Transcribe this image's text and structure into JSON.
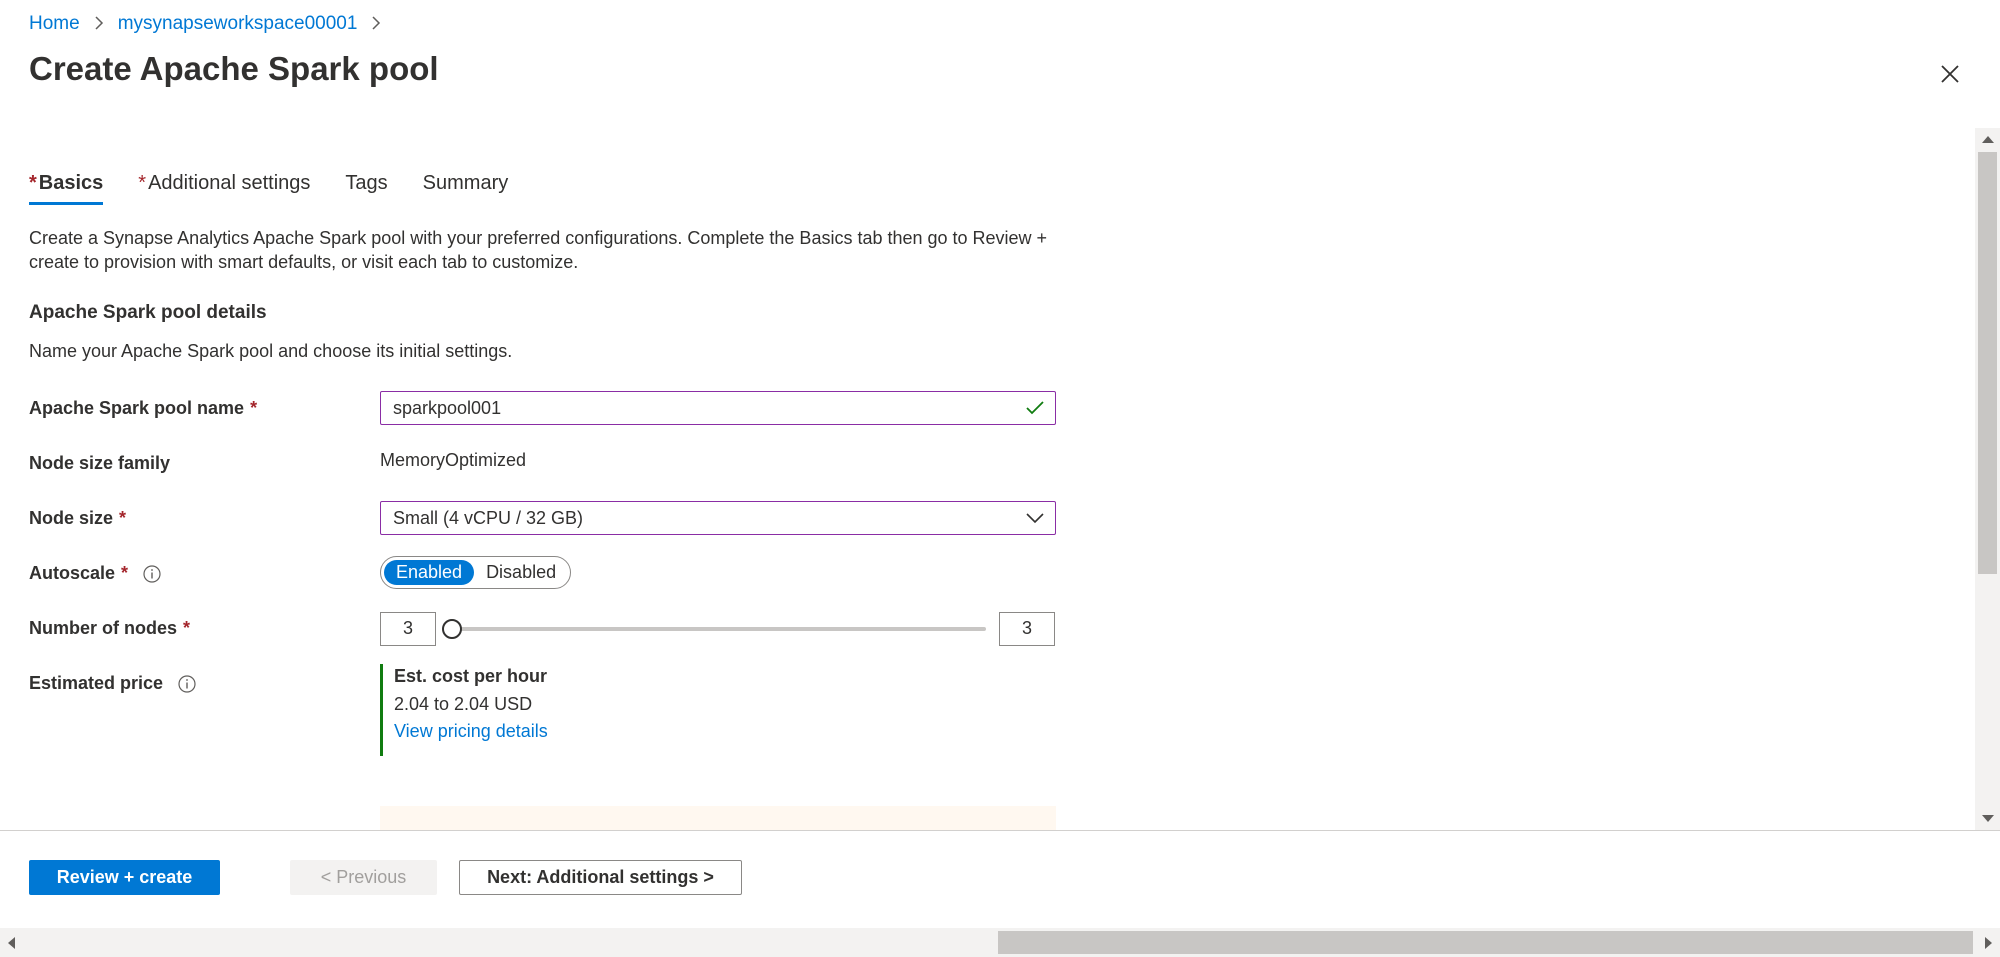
{
  "breadcrumb": {
    "home": "Home",
    "workspace": "mysynapseworkspace00001"
  },
  "page_title": "Create Apache Spark pool",
  "tabs": [
    {
      "label": "Basics",
      "required": "*",
      "active": true
    },
    {
      "label": "Additional settings",
      "required": "*",
      "active": false
    },
    {
      "label": "Tags",
      "required": "",
      "active": false
    },
    {
      "label": "Summary",
      "required": "",
      "active": false
    }
  ],
  "intro": "Create a Synapse Analytics Apache Spark pool with your preferred configurations. Complete the Basics tab then go to Review + create to provision with smart defaults, or visit each tab to customize.",
  "section": {
    "title": "Apache Spark pool details",
    "description": "Name your Apache Spark pool and choose its initial settings."
  },
  "fields": {
    "pool_name": {
      "label": "Apache Spark pool name",
      "required": "*",
      "value": "sparkpool001"
    },
    "node_size_family": {
      "label": "Node size family",
      "value": "MemoryOptimized"
    },
    "node_size": {
      "label": "Node size",
      "required": "*",
      "value": "Small (4 vCPU / 32 GB)"
    },
    "autoscale": {
      "label": "Autoscale",
      "required": "*",
      "options": [
        "Enabled",
        "Disabled"
      ],
      "selected": "Enabled"
    },
    "number_of_nodes": {
      "label": "Number of nodes",
      "required": "*",
      "min_value": "3",
      "max_value": "3",
      "slider_level": 0
    },
    "estimated_price": {
      "label": "Estimated price",
      "title": "Est. cost per hour",
      "range": "2.04 to 2.04 USD",
      "link": "View pricing details"
    }
  },
  "footer": {
    "review_create": "Review + create",
    "previous": "< Previous",
    "next": "Next: Additional settings >"
  },
  "colors": {
    "accent": "#0078d4",
    "required": "#a4262c",
    "focus_border": "#8a2da5",
    "success": "#107c10"
  }
}
